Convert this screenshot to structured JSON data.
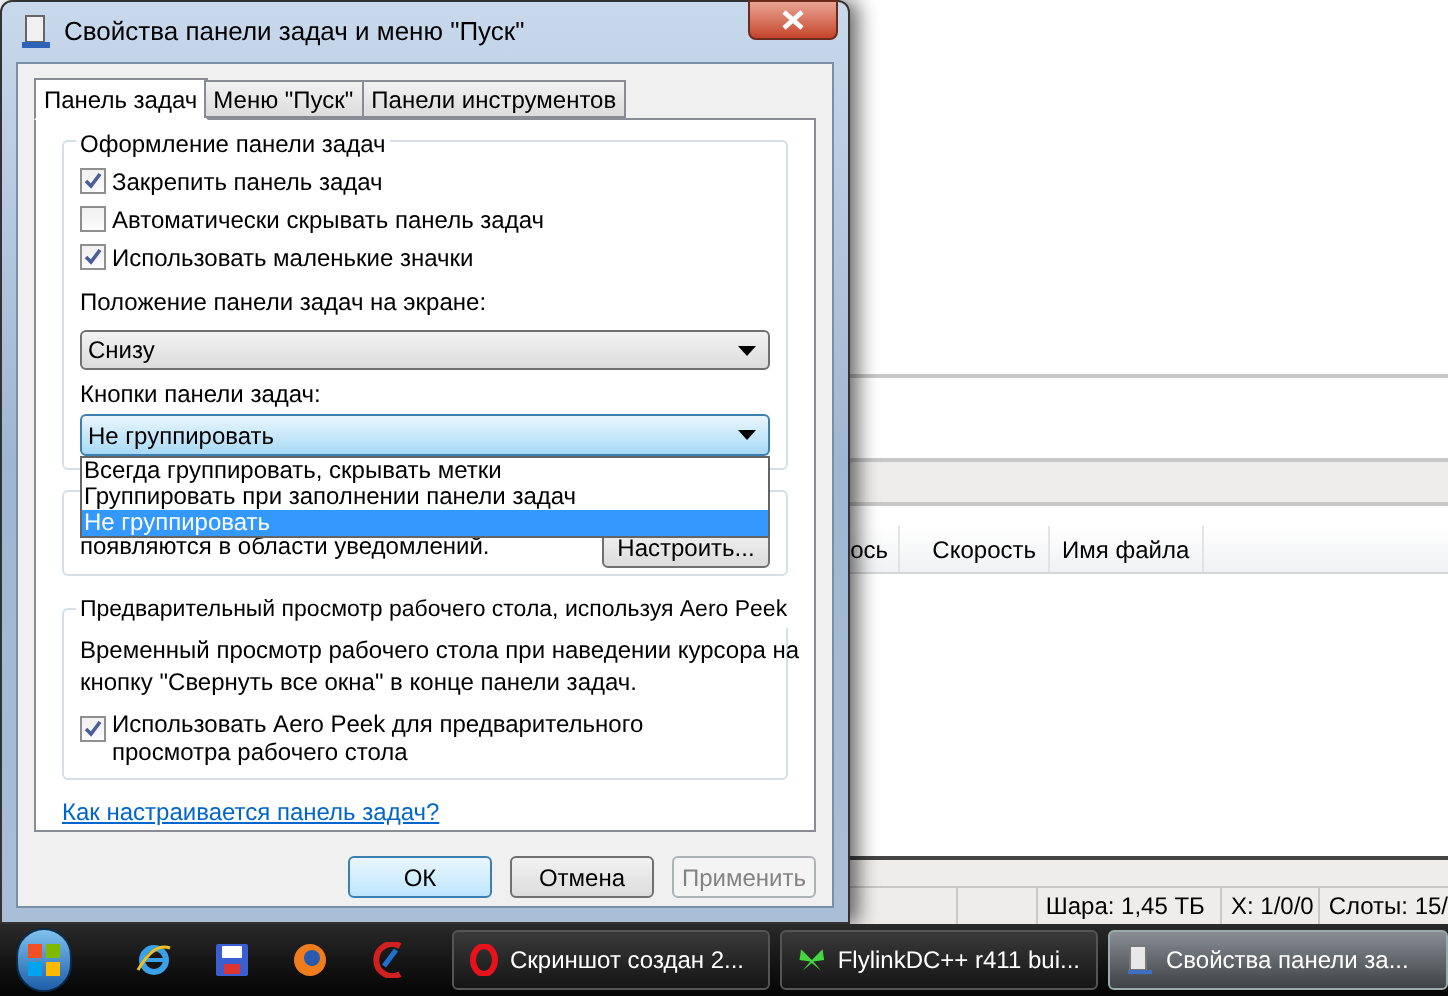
{
  "dialog": {
    "title": "Свойства панели задач и меню \"Пуск\"",
    "tabs": [
      {
        "label": "Панель задач",
        "selected": true
      },
      {
        "label": "Меню \"Пуск\"",
        "selected": false
      },
      {
        "label": "Панели инструментов",
        "selected": false
      }
    ],
    "appearance": {
      "legend": "Оформление панели задач",
      "checkboxes": [
        {
          "label": "Закрепить панель задач",
          "checked": true
        },
        {
          "label": "Автоматически скрывать панель задач",
          "checked": false
        },
        {
          "label": "Использовать маленькие значки",
          "checked": true
        }
      ],
      "position_label": "Положение панели задач на экране:",
      "position_select": {
        "value": "Снизу"
      },
      "buttons_label": "Кнопки панели задач:",
      "buttons_select": {
        "value": "Не группировать",
        "expanded": true,
        "options": [
          {
            "label": "Всегда группировать, скрывать метки",
            "selected": false
          },
          {
            "label": "Группировать при заполнении панели задач",
            "selected": false
          },
          {
            "label": "Не группировать",
            "selected": true
          }
        ]
      }
    },
    "notification": {
      "text": "появляются в области уведомлений.",
      "button": "Настроить..."
    },
    "peek": {
      "legend": "Предварительный просмотр рабочего стола, используя Aero Peek",
      "text": "Временный просмотр рабочего стола при наведении курсора на кнопку \"Свернуть все окна\" в конце панели задач.",
      "checkbox": {
        "label": "Использовать Aero Peek для предварительного просмотра рабочего стола",
        "checked": true
      }
    },
    "help_link": "Как настраивается панель задач?",
    "actions": [
      {
        "label": "ОК",
        "disabled": false,
        "default": true
      },
      {
        "label": "Отмена",
        "disabled": false,
        "default": false
      },
      {
        "label": "Применить",
        "disabled": true,
        "default": false
      }
    ]
  },
  "background_app": {
    "columns": [
      "ось",
      "Скорость",
      "Имя файла"
    ],
    "status_bar": [
      "Шара: 1,45 ТБ",
      "X: 1/0/0",
      "Слоты: 15/"
    ]
  },
  "taskbar": {
    "tasks": [
      {
        "label": "Скриншот создан 2...",
        "kind": "browser",
        "selected": false
      },
      {
        "label": "FlylinkDC++ r411 bui...",
        "kind": "butterfly",
        "selected": false
      },
      {
        "label": "Свойства панели за...",
        "kind": "settings",
        "selected": true
      }
    ]
  }
}
